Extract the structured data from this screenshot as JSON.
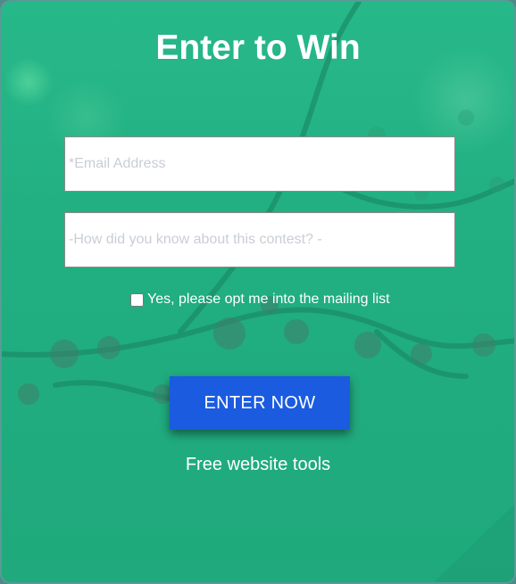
{
  "form": {
    "title": "Enter to Win",
    "email_placeholder": "*Email Address",
    "source_placeholder": "-How did you know about this contest? -",
    "optin_label": "Yes, please opt me into the mailing list",
    "optin_checked": false,
    "submit_label": "ENTER NOW",
    "footer_link": "Free website tools"
  },
  "colors": {
    "background_green": "#22b083",
    "button_blue": "#1b5be0",
    "text": "#ffffff"
  }
}
